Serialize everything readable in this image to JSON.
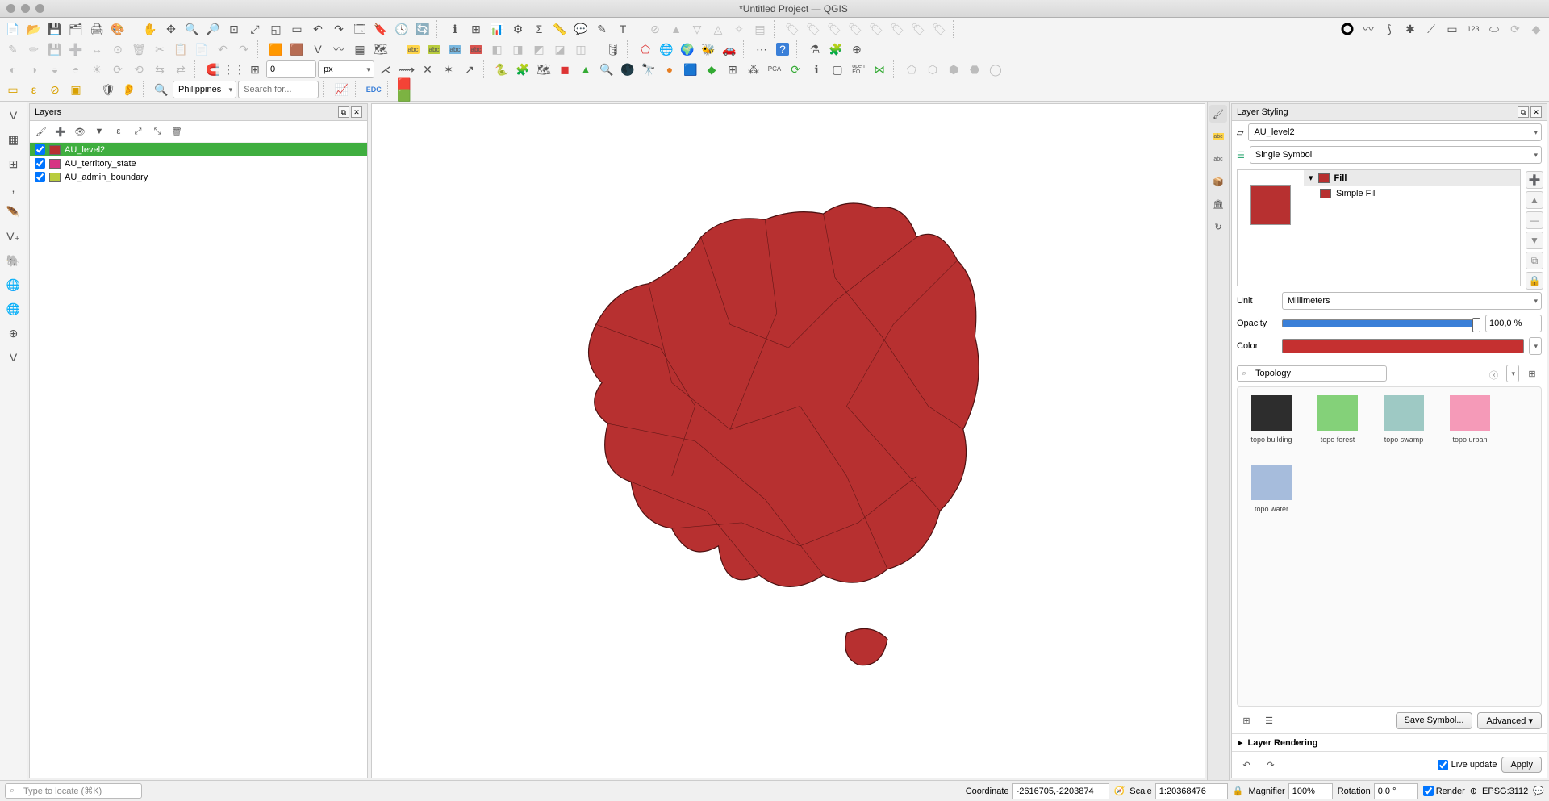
{
  "window": {
    "title": "*Untitled Project — QGIS"
  },
  "toolbar2": {
    "px_value": "0",
    "px_unit": "px"
  },
  "nominatim": {
    "region": "Philippines",
    "search_placeholder": "Search for..."
  },
  "layers_panel": {
    "title": "Layers",
    "items": [
      {
        "name": "AU_level2",
        "checked": true,
        "color": "#b73030",
        "selected": true
      },
      {
        "name": "AU_territory_state",
        "checked": true,
        "color": "#d63384",
        "selected": false
      },
      {
        "name": "AU_admin_boundary",
        "checked": true,
        "color": "#b9cc3e",
        "selected": false
      }
    ]
  },
  "styling": {
    "title": "Layer Styling",
    "layer_selected": "AU_level2",
    "symbol_mode": "Single Symbol",
    "fill_group": "Fill",
    "fill_type": "Simple Fill",
    "unit_label": "Unit",
    "unit_value": "Millimeters",
    "opacity_label": "Opacity",
    "opacity_value": "100,0 %",
    "color_label": "Color",
    "color_value": "#c53030",
    "topology_search": "Topology",
    "swatches": [
      {
        "label": "topo building",
        "color": "#2d2d2d"
      },
      {
        "label": "topo forest",
        "color": "#84d179"
      },
      {
        "label": "topo swamp",
        "color": "#9ec9c4"
      },
      {
        "label": "topo urban",
        "color": "#f59ab8"
      },
      {
        "label": "topo water",
        "color": "#a6bcdc"
      }
    ],
    "save_symbol": "Save Symbol...",
    "advanced": "Advanced",
    "layer_rendering": "Layer Rendering",
    "live_update": "Live update",
    "apply": "Apply"
  },
  "statusbar": {
    "locator_placeholder": "Type to locate (⌘K)",
    "coord_label": "Coordinate",
    "coord_value": "-2616705,-2203874",
    "scale_label": "Scale",
    "scale_value": "1:20368476",
    "magnifier_label": "Magnifier",
    "magnifier_value": "100%",
    "rotation_label": "Rotation",
    "rotation_value": "0,0 °",
    "render_label": "Render",
    "crs": "EPSG:3112"
  }
}
